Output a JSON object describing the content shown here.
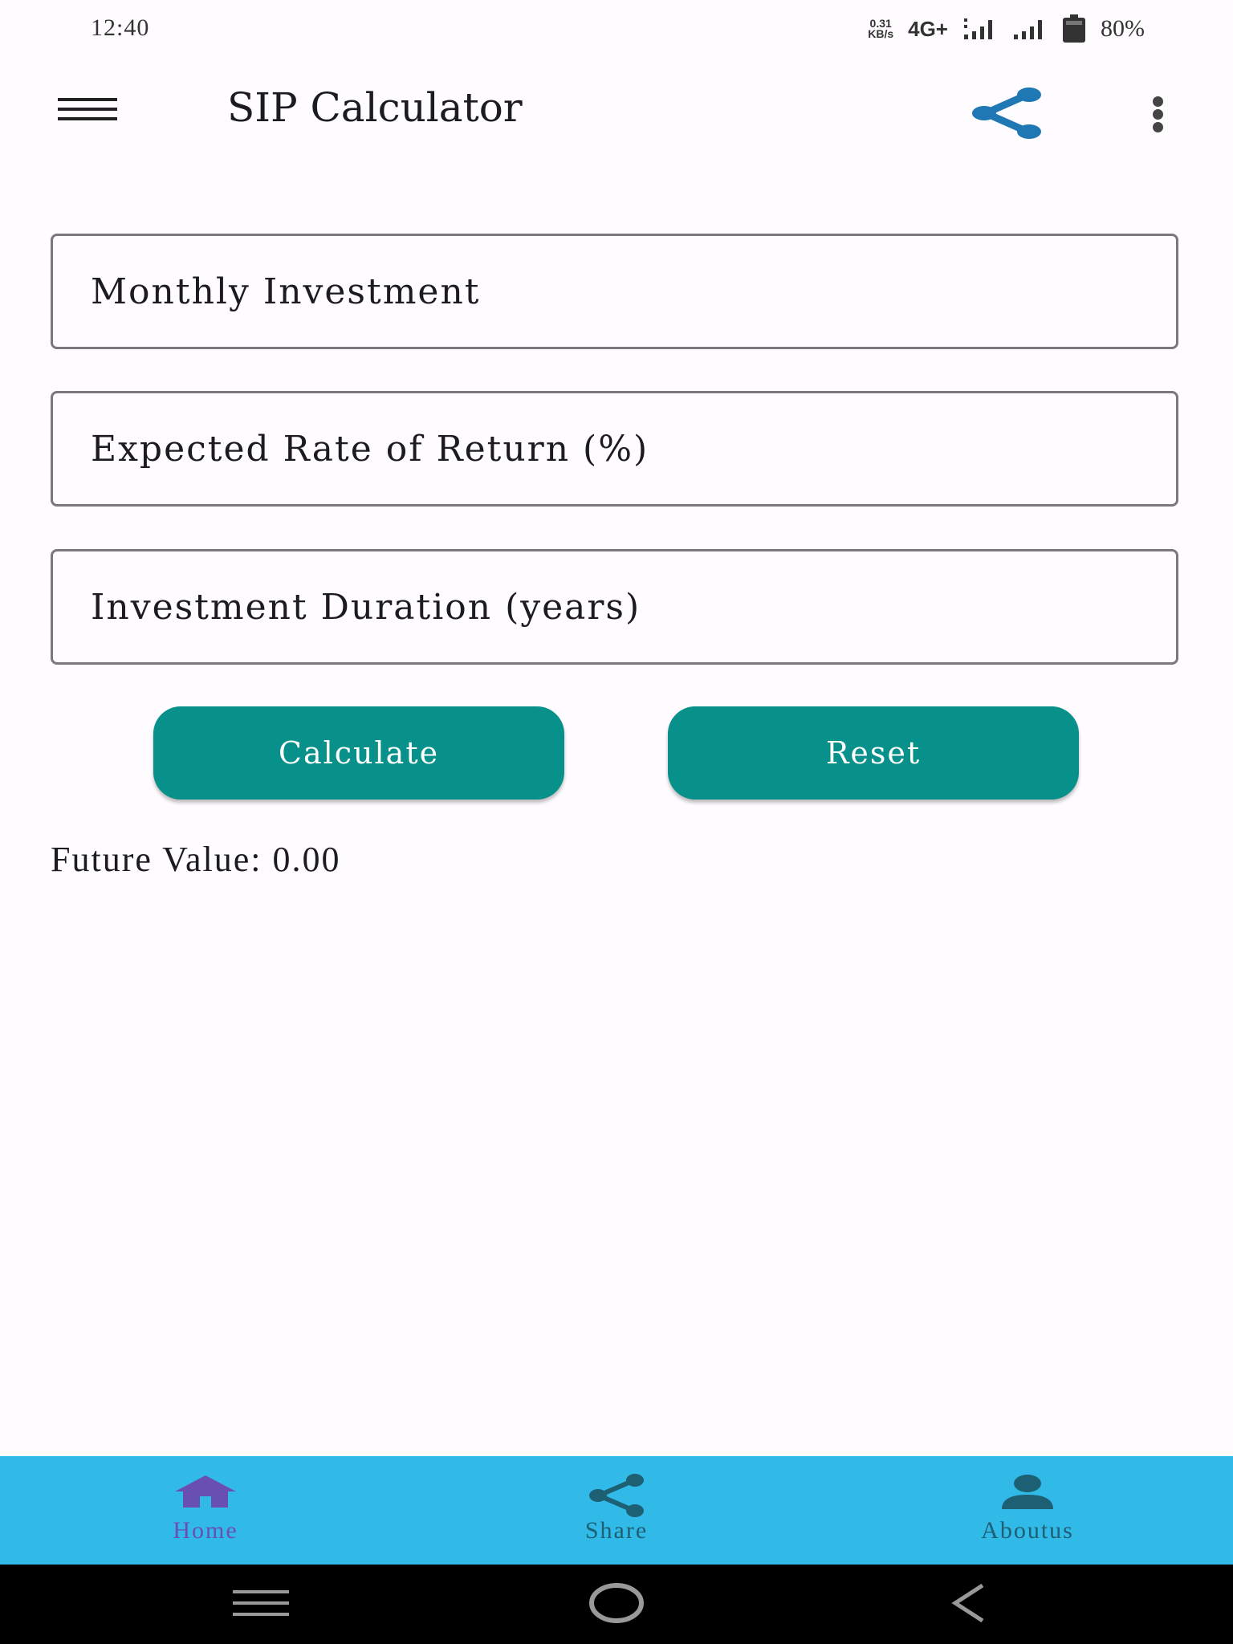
{
  "status_bar": {
    "time": "12:40",
    "net_speed_value": "0.31",
    "net_speed_unit": "KB/s",
    "network_type": "4G+",
    "battery": "80%"
  },
  "app_bar": {
    "title": "SIP Calculator",
    "icons": [
      "menu-icon",
      "share-icon",
      "more-vert-icon"
    ],
    "share_color": "#1f77b4"
  },
  "form": {
    "monthly_investment_placeholder": "Monthly Investment",
    "rate_placeholder": "Expected Rate of Return (%)",
    "duration_placeholder": "Investment Duration (years)",
    "monthly_investment_value": "",
    "rate_value": "",
    "duration_value": ""
  },
  "buttons": {
    "calculate_label": "Calculate",
    "reset_label": "Reset",
    "color": "#07918a"
  },
  "result": {
    "future_value_text": "Future Value: 0.00"
  },
  "bottom_nav": {
    "background": "#31b9e7",
    "items": [
      {
        "label": "Home",
        "icon": "home-icon",
        "active": true,
        "color": "#6a4fb3"
      },
      {
        "label": "Share",
        "icon": "share-icon",
        "active": false,
        "color": "#1d5f73"
      },
      {
        "label": "Aboutus",
        "icon": "person-icon",
        "active": false,
        "color": "#1d5f73"
      }
    ]
  },
  "system_nav": {
    "buttons": [
      "recent-apps-icon",
      "home-circle-icon",
      "back-icon"
    ]
  }
}
